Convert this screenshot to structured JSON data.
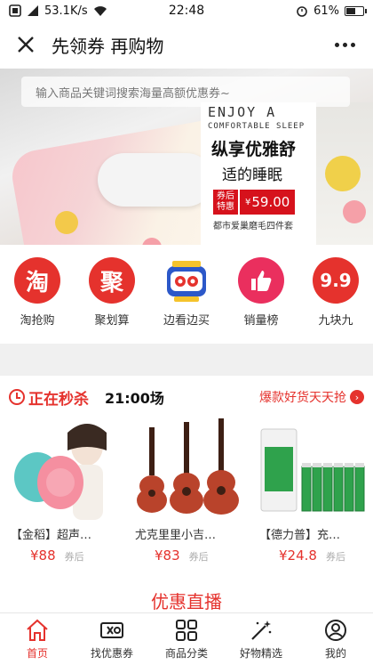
{
  "status_bar": {
    "network_speed": "53.1K/s",
    "time": "22:48",
    "battery": "61%",
    "battery_level": 0.61
  },
  "nav": {
    "title": "先领券 再购物"
  },
  "banner": {
    "search_placeholder": "输入商品关键词搜索海量高额优惠券~",
    "enjoy": "ENJOY A",
    "comfortable": "COMFORTABLE SLEEP",
    "headline1": "纵享优雅舒",
    "headline2": "适的睡眠",
    "coupon_tag": "券后特惠",
    "price_symbol": "¥",
    "price": "59.00",
    "subtitle": "都市爱巢磨毛四件套"
  },
  "categories": [
    {
      "label": "淘抢购",
      "icon_text": "淘",
      "icon": "tao-icon"
    },
    {
      "label": "聚划算",
      "icon_text": "聚",
      "icon": "ju-icon"
    },
    {
      "label": "边看边买",
      "icon_text": "",
      "icon": "watch-buy-icon"
    },
    {
      "label": "销量榜",
      "icon_text": "",
      "icon": "thumbs-up-icon"
    },
    {
      "label": "九块九",
      "icon_text": "9.9",
      "icon": "nine-nine-icon"
    }
  ],
  "flash_sale": {
    "title": "正在秒杀",
    "time": "21:00场",
    "more": "爆款好货天天抢",
    "more_chevron": "›"
  },
  "products": [
    {
      "title": "【金稻】超声…",
      "price": "¥88",
      "after": "券后"
    },
    {
      "title": "尤克里里小吉…",
      "price": "¥83",
      "after": "券后"
    },
    {
      "title": "【德力普】充…",
      "price": "¥24.8",
      "after": "券后"
    }
  ],
  "live": {
    "title": "优惠直播"
  },
  "tabs": [
    {
      "label": "首页",
      "icon": "home-icon",
      "active": true
    },
    {
      "label": "找优惠券",
      "icon": "coupon-icon",
      "active": false
    },
    {
      "label": "商品分类",
      "icon": "grid-icon",
      "active": false
    },
    {
      "label": "好物精选",
      "icon": "magic-wand-icon",
      "active": false
    },
    {
      "label": "我的",
      "icon": "user-icon",
      "active": false
    }
  ],
  "colors": {
    "accent": "#e5322d",
    "banner_price": "#d6121c"
  }
}
